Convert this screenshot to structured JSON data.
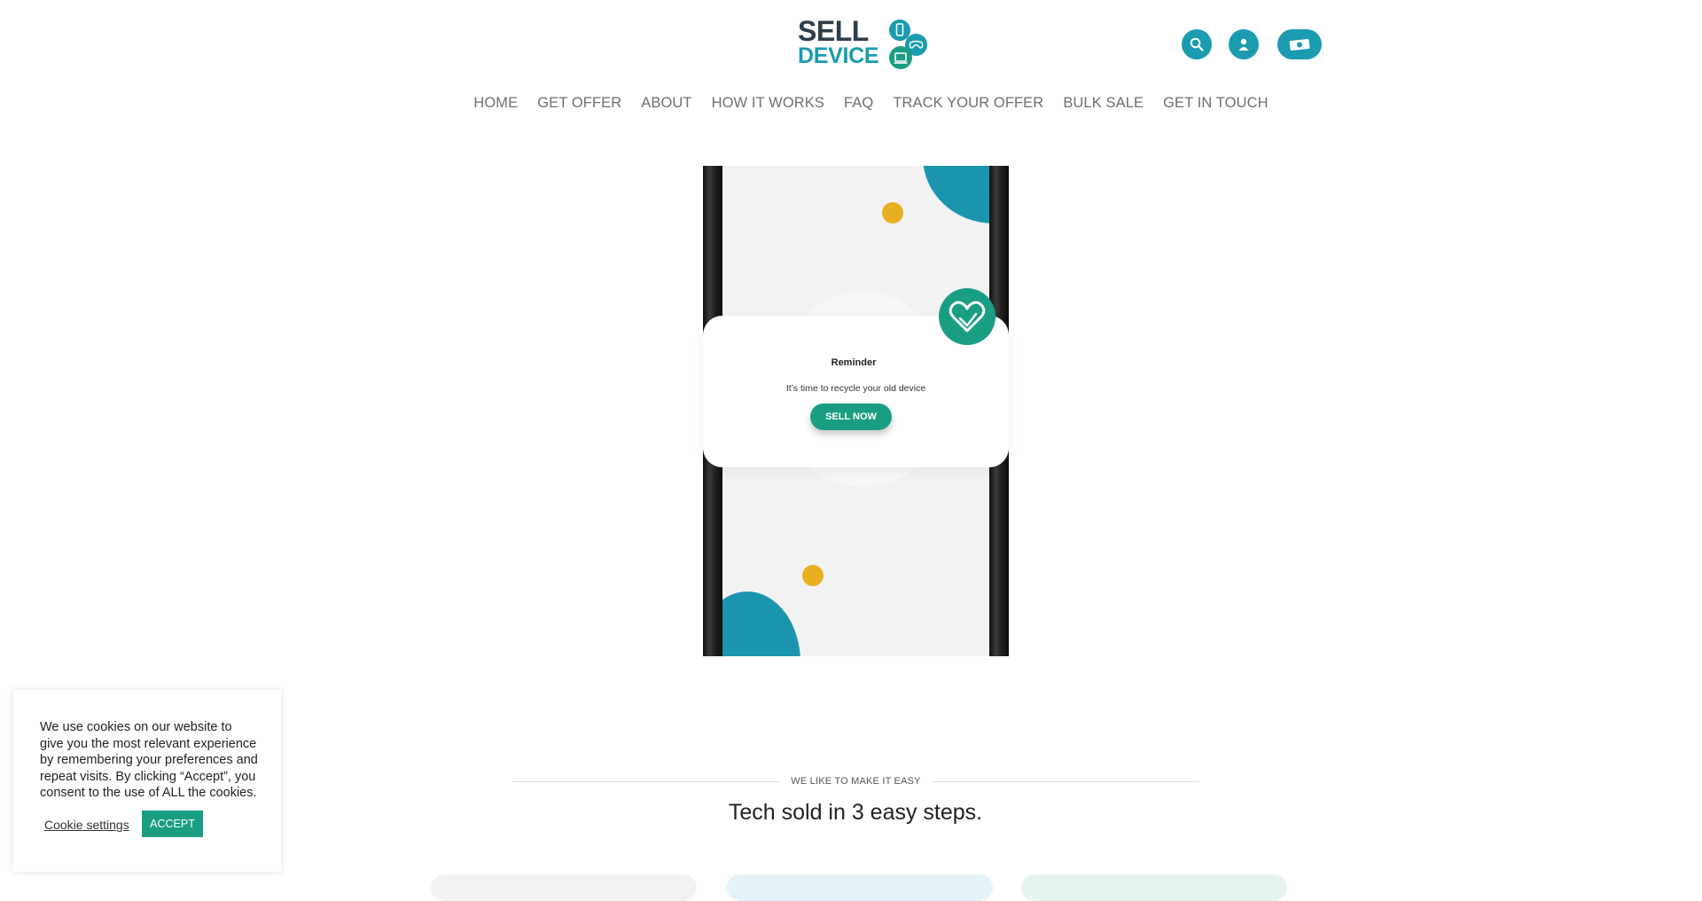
{
  "brand": {
    "logo_line1": "SELL",
    "logo_line2": "DEVICE",
    "primary_color": "#1a9bb0",
    "secondary_color": "#1a9e83",
    "dark_color": "#2f3e4a"
  },
  "header": {
    "icons": [
      "search-icon",
      "user-icon",
      "cash-icon"
    ]
  },
  "nav": {
    "items": [
      "HOME",
      "GET OFFER",
      "ABOUT",
      "HOW IT WORKS",
      "FAQ",
      "TRACK YOUR OFFER",
      "BULK SALE",
      "GET IN TOUCH"
    ]
  },
  "hero": {
    "card_title": "Reminder",
    "card_text": "It’s time to recycle your old device",
    "cta_label": "SELL NOW",
    "accent_yellow": "#e8b020"
  },
  "steps_section": {
    "label": "WE LIKE TO MAKE IT EASY",
    "title": "Tech sold in 3 easy steps."
  },
  "cookie_banner": {
    "text": "We use cookies on our website to give you the most relevant experience by remembering your preferences and repeat visits. By clicking “Accept”, you consent to the use of ALL the cookies.",
    "settings_label": "Cookie settings",
    "accept_label": "ACCEPT"
  }
}
